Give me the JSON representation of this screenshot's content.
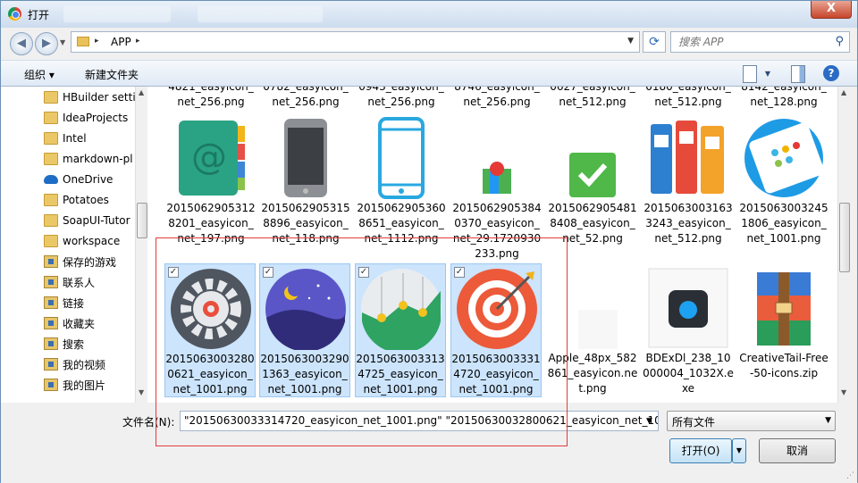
{
  "window": {
    "title": "打开",
    "close_label": "X"
  },
  "nav": {
    "back_icon": "back-arrow-icon",
    "forward_icon": "forward-arrow-icon",
    "path": "APP",
    "search_placeholder": "搜索 APP"
  },
  "toolbar": {
    "organize_label": "组织 ▾",
    "new_folder_label": "新建文件夹",
    "help_label": "?"
  },
  "sidebar": {
    "items": [
      {
        "label": "HBuilder setti",
        "icon": "folder-icon"
      },
      {
        "label": "IdeaProjects",
        "icon": "folder-icon"
      },
      {
        "label": "Intel",
        "icon": "folder-icon"
      },
      {
        "label": "markdown-pl",
        "icon": "folder-icon"
      },
      {
        "label": "OneDrive",
        "icon": "cloud-icon"
      },
      {
        "label": "Potatoes",
        "icon": "folder-icon"
      },
      {
        "label": "SoapUI-Tutor",
        "icon": "folder-icon"
      },
      {
        "label": "workspace",
        "icon": "folder-icon"
      },
      {
        "label": "保存的游戏",
        "icon": "saved-games-icon"
      },
      {
        "label": "联系人",
        "icon": "contacts-icon"
      },
      {
        "label": "链接",
        "icon": "links-icon"
      },
      {
        "label": "收藏夹",
        "icon": "favorites-icon"
      },
      {
        "label": "搜索",
        "icon": "search-folder-icon"
      },
      {
        "label": "我的视频",
        "icon": "videos-icon"
      },
      {
        "label": "我的图片",
        "icon": "pictures-icon"
      }
    ]
  },
  "files_top_partial": [
    "4821_easyicon_\nnet_256.png",
    "0782_easyicon_\nnet_256.png",
    "0943_easyicon_\nnet_256.png",
    "8746_easyicon_\nnet_256.png",
    "0627_easyicon_\nnet_512.png",
    "0180_easyicon_\nnet_512.png",
    "8142_easyicon_\nnet_128.png"
  ],
  "files_row1": [
    {
      "name": "20150629053128201_easyicon_net_197.png",
      "icon": "address-book-icon"
    },
    {
      "name": "20150629053158896_easyicon_net_118.png",
      "icon": "phone-gray-icon"
    },
    {
      "name": "20150629053608651_easyicon_net_1112.png",
      "icon": "phone-outline-icon"
    },
    {
      "name": "20150629053840370_easyicon_net_29.1720930233.png",
      "icon": "map-icon"
    },
    {
      "name": "20150629054818408_easyicon_net_52.png",
      "icon": "checkmark-icon"
    },
    {
      "name": "20150630031633243_easyicon_net_512.png",
      "icon": "binders-icon"
    },
    {
      "name": "20150630032451806_easyicon_net_1001.png",
      "icon": "iphone-color-icon"
    }
  ],
  "files_row2": [
    {
      "name": "20150630032800621_easyicon_net_1001.png",
      "icon": "gear-icon",
      "selected": true
    },
    {
      "name": "20150630032901363_easyicon_net_1001.png",
      "icon": "night-moon-icon",
      "selected": true
    },
    {
      "name": "20150630033134725_easyicon_net_1001.png",
      "icon": "chart-hills-icon",
      "selected": true
    },
    {
      "name": "20150630033314720_easyicon_net_1001.png",
      "icon": "target-icon",
      "selected": true
    },
    {
      "name": "Apple_48px_582861_easyicon.net.png",
      "icon": "blank-image-icon",
      "selected": false
    },
    {
      "name": "BDExDl_238_10000004_1032X.exe",
      "icon": "app-box-icon",
      "selected": false
    },
    {
      "name": "CreativeTail-Free-50-icons.zip",
      "icon": "winrar-archive-icon",
      "selected": false
    }
  ],
  "bottom": {
    "filename_label": "文件名(N):",
    "filename_value": "\"20150630033314720_easyicon_net_1001.png\" \"20150630032800621_easyicon_net_1001.p",
    "filetype": "所有文件",
    "open_label": "打开(O)",
    "cancel_label": "取消"
  }
}
